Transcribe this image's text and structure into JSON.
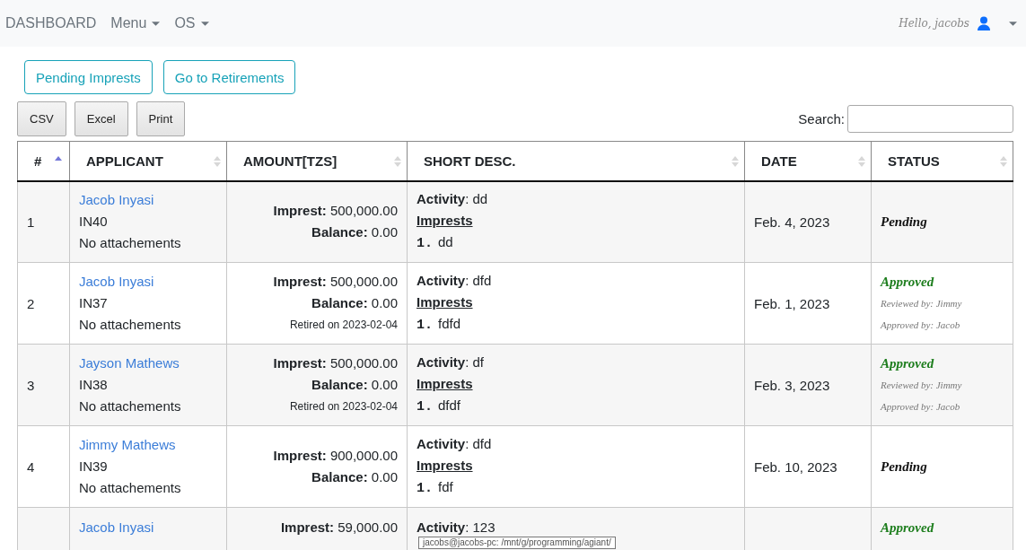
{
  "navbar": {
    "brand": "DASHBOARD",
    "menus": [
      {
        "label": "Menu"
      },
      {
        "label": "OS"
      }
    ],
    "greeting": "Hello, jacobs"
  },
  "actions": [
    {
      "label": "Pending Imprests"
    },
    {
      "label": "Go to Retirements"
    }
  ],
  "export_buttons": [
    {
      "label": "CSV"
    },
    {
      "label": "Excel"
    },
    {
      "label": "Print"
    }
  ],
  "search": {
    "label": "Search:"
  },
  "table": {
    "columns": [
      {
        "label": "#",
        "sorted": true
      },
      {
        "label": "APPLICANT",
        "sorted": false
      },
      {
        "label": "AMOUNT[TZS]",
        "sorted": false
      },
      {
        "label": "SHORT DESC.",
        "sorted": false
      },
      {
        "label": "DATE",
        "sorted": false
      },
      {
        "label": "STATUS",
        "sorted": false
      }
    ],
    "rows": [
      {
        "number": "1",
        "applicant": "Jacob Inyasi",
        "code": "IN40",
        "attachments": "No attachements",
        "imprest_label": "Imprest:",
        "imprest": "500,000.00",
        "balance_label": "Balance:",
        "balance": "0.00",
        "activity": "**Activity**: dd",
        "imprests_heading": "Imprests",
        "items": [
          {
            "marker": "1.",
            "text": "dd"
          }
        ],
        "date": "Feb. 4, 2023",
        "status": {
          "kind": "pending",
          "label": "Pending"
        }
      },
      {
        "number": "2",
        "applicant": "Jacob Inyasi",
        "code": "IN37",
        "attachments": "No attachements",
        "imprest_label": "Imprest:",
        "imprest": "500,000.00",
        "balance_label": "Balance:",
        "balance": "0.00",
        "retired": "Retired on 2023-02-04",
        "activity": "**Activity**: dfd",
        "imprests_heading": "Imprests",
        "items": [
          {
            "marker": "1.",
            "text": "fdfd"
          }
        ],
        "date": "Feb. 1, 2023",
        "status": {
          "kind": "approved",
          "label": "Approved",
          "reviewed": "Reviewed by: Jimmy",
          "approved": "Approved by: Jacob"
        }
      },
      {
        "number": "3",
        "applicant": "Jayson Mathews",
        "code": "IN38",
        "attachments": "No attachements",
        "imprest_label": "Imprest:",
        "imprest": "500,000.00",
        "balance_label": "Balance:",
        "balance": "0.00",
        "retired": "Retired on 2023-02-04",
        "activity": "**Activity**: df",
        "imprests_heading": "Imprests",
        "items": [
          {
            "marker": "1.",
            "text": "dfdf"
          }
        ],
        "date": "Feb. 3, 2023",
        "status": {
          "kind": "approved",
          "label": "Approved",
          "reviewed": "Reviewed by: Jimmy",
          "approved": "Approved by: Jacob"
        }
      },
      {
        "number": "4",
        "applicant": "Jimmy Mathews",
        "code": "IN39",
        "attachments": "No attachements",
        "imprest_label": "Imprest:",
        "imprest": "900,000.00",
        "balance_label": "Balance:",
        "balance": "0.00",
        "activity": "**Activity**: dfd",
        "imprests_heading": "Imprests",
        "items": [
          {
            "marker": "1.",
            "text": "fdf"
          }
        ],
        "date": "Feb. 10, 2023",
        "status": {
          "kind": "pending",
          "label": "Pending"
        }
      },
      {
        "applicant": "Jacob Inyasi",
        "imprest_label": "Imprest:",
        "imprest": "59,000.00",
        "activity": "**Activity**: 123",
        "status": {
          "kind": "approved",
          "label": "Approved"
        }
      }
    ]
  },
  "tooltip": "jacobs@jacobs-pc: /mnt/g/programming/agiant/"
}
